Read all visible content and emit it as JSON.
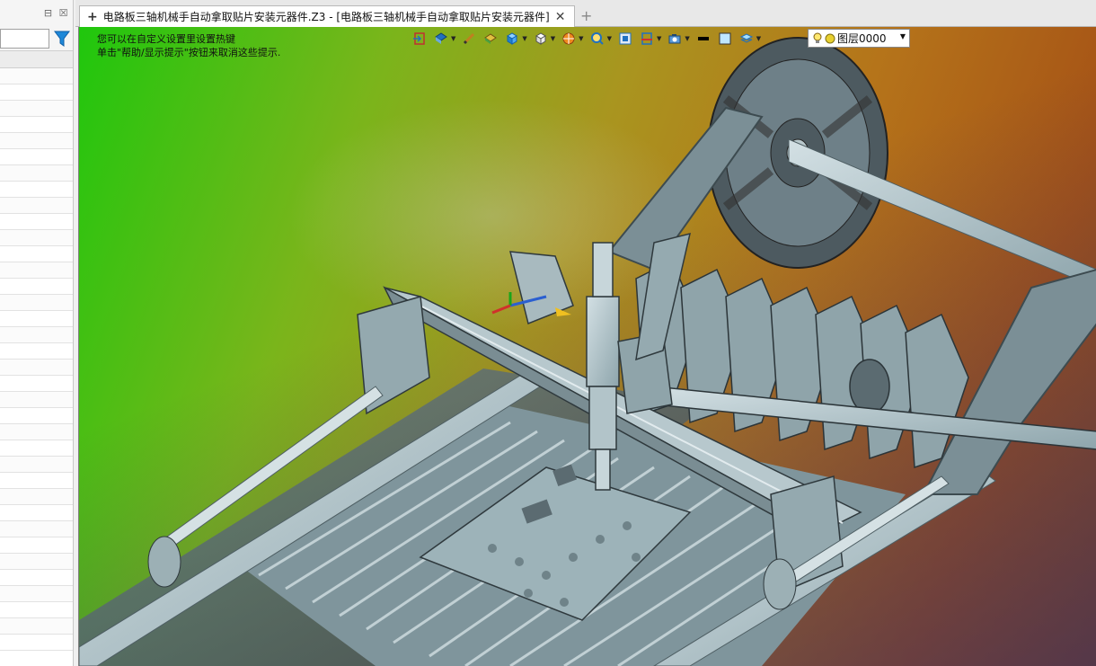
{
  "left_panel": {
    "panel_buttons": [
      "⊟",
      "☒"
    ],
    "filter_placeholder": "",
    "rows": 36
  },
  "tab": {
    "pin": "+",
    "title": "电路板三轴机械手自动拿取贴片安装元器件.Z3 - [电路板三轴机械手自动拿取贴片安装元器件]",
    "close": "✕",
    "add": "+"
  },
  "viewport": {
    "hint_line1": "您可以在自定义设置里设置热键",
    "hint_line2": "单击\"帮助/显示提示\"按钮来取消这些提示."
  },
  "toolbar": {
    "icons": [
      "exit-sketch-icon",
      "view-mode-icon",
      "pen-icon",
      "shaded-icon",
      "cube-display-icon",
      "view-cube-icon",
      "render-style-icon",
      "zoom-icon",
      "fit-view-icon",
      "section-icon",
      "camera-icon",
      "line-color-icon",
      "fill-color-icon",
      "layer-filter-icon"
    ],
    "layer_label": "图层0000"
  },
  "colors": {
    "gradient_green": "#1fc70d",
    "gradient_orange": "#b5741a",
    "gradient_blue": "#28286e",
    "metal": "#aec2c8"
  }
}
